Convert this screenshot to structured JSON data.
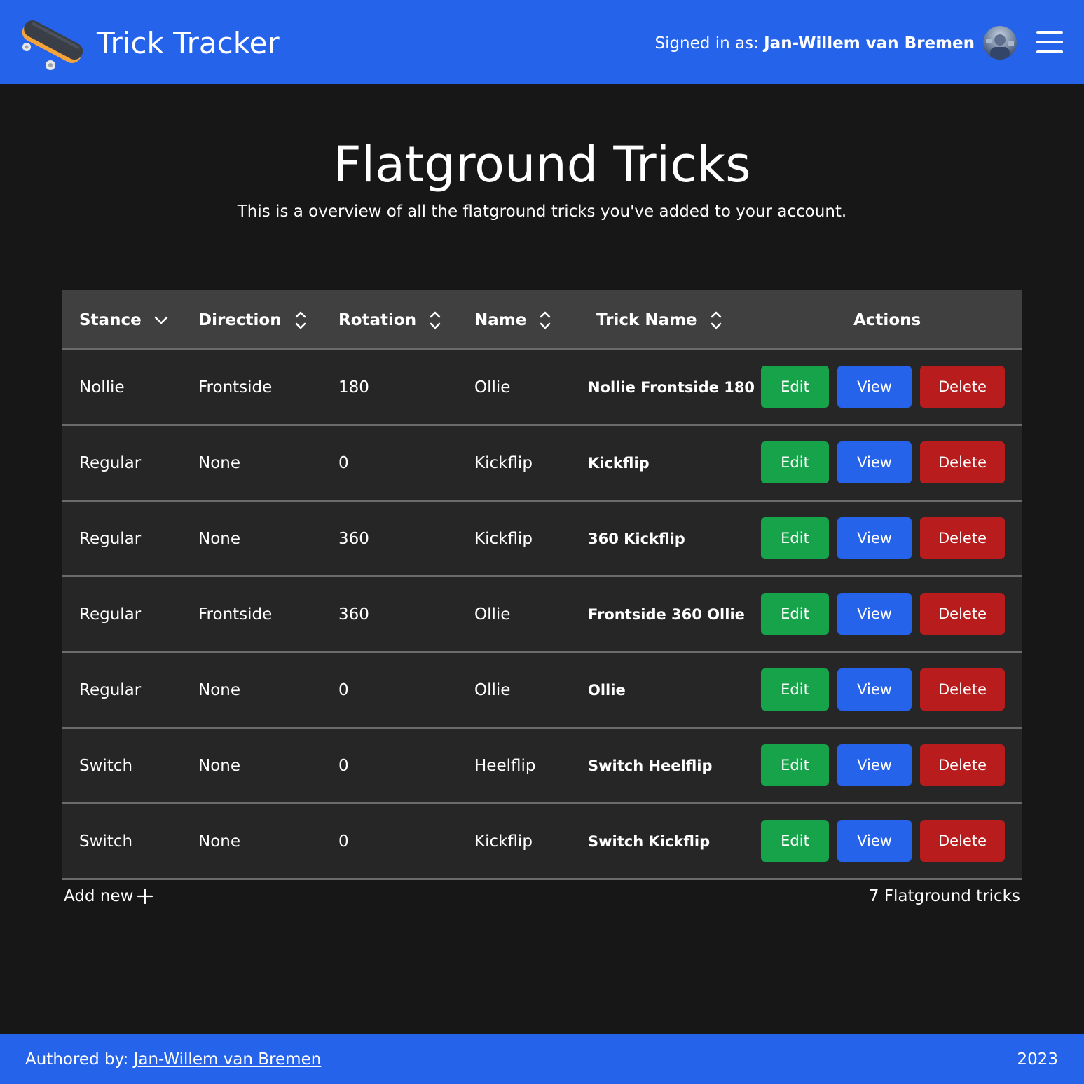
{
  "header": {
    "app_title": "Trick Tracker",
    "signed_in_prefix": "Signed in as: ",
    "user_name": "Jan-Willem van Bremen"
  },
  "hero": {
    "title": "Flatground Tricks",
    "subtitle": "This is a overview of all the flatground tricks you've added to your account."
  },
  "table": {
    "columns": {
      "stance": "Stance",
      "direction": "Direction",
      "rotation": "Rotation",
      "name": "Name",
      "trick_name": "Trick Name",
      "actions": "Actions"
    },
    "sort": {
      "stance": "descending"
    },
    "button_labels": {
      "edit": "Edit",
      "view": "View",
      "delete": "Delete"
    },
    "rows": [
      {
        "stance": "Nollie",
        "direction": "Frontside",
        "rotation": "180",
        "name": "Ollie",
        "trick_name": "Nollie Frontside 180"
      },
      {
        "stance": "Regular",
        "direction": "None",
        "rotation": "0",
        "name": "Kickflip",
        "trick_name": "Kickflip"
      },
      {
        "stance": "Regular",
        "direction": "None",
        "rotation": "360",
        "name": "Kickflip",
        "trick_name": "360 Kickflip"
      },
      {
        "stance": "Regular",
        "direction": "Frontside",
        "rotation": "360",
        "name": "Ollie",
        "trick_name": "Frontside 360 Ollie"
      },
      {
        "stance": "Regular",
        "direction": "None",
        "rotation": "0",
        "name": "Ollie",
        "trick_name": "Ollie"
      },
      {
        "stance": "Switch",
        "direction": "None",
        "rotation": "0",
        "name": "Heelflip",
        "trick_name": "Switch Heelflip"
      },
      {
        "stance": "Switch",
        "direction": "None",
        "rotation": "0",
        "name": "Kickflip",
        "trick_name": "Switch Kickflip"
      }
    ],
    "add_new_label": "Add new",
    "count_label": "7 Flatground tricks"
  },
  "footer": {
    "authored_prefix": "Authored by: ",
    "author_link": "Jan-Willem van Bremen",
    "year": "2023"
  },
  "colors": {
    "brand_blue": "#2563eb",
    "edit_green": "#16a34a",
    "view_blue": "#2563eb",
    "delete_red": "#b91c1c",
    "page_bg": "#171717",
    "row_bg": "#262626",
    "header_row_bg": "#404040"
  },
  "icons": {
    "logo": "skateboard-logo",
    "avatar": "user-avatar",
    "menu": "hamburger-menu-icon",
    "sort_desc": "chevron-down-icon",
    "sort_both": "sort-updown-icon",
    "add": "plus-icon"
  }
}
